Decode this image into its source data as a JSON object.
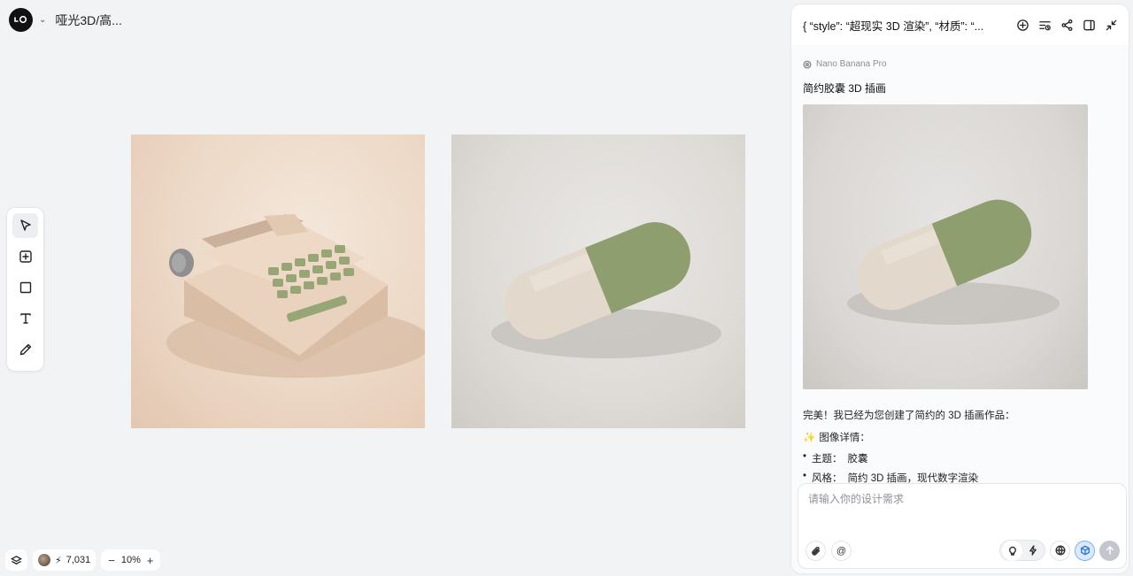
{
  "project": {
    "title": "哑光3D/高..."
  },
  "tools": [
    {
      "name": "select-tool",
      "icon": "cursor-icon",
      "active": true
    },
    {
      "name": "add-frame-tool",
      "icon": "add-square-icon",
      "active": false
    },
    {
      "name": "rectangle-tool",
      "icon": "square-icon",
      "active": false
    },
    {
      "name": "text-tool",
      "icon": "text-icon",
      "active": false
    },
    {
      "name": "pen-tool",
      "icon": "pen-icon",
      "active": false
    }
  ],
  "canvas": {
    "images": [
      {
        "subject": "typewriter",
        "bg": "#ecd8c6",
        "body": "#e6cdb5",
        "keys": "#98a675"
      },
      {
        "subject": "capsule",
        "bg": "#dedbd7",
        "left_color": "#e3d8cc",
        "right_color": "#8e9e6e"
      }
    ]
  },
  "status": {
    "credits": "7,031",
    "zoom": "10%",
    "zoom_out": "−",
    "zoom_in": "+",
    "bolt": "⚡"
  },
  "panel": {
    "title": "{ “style”: “超现实 3D 渲染”, “材质”: “...",
    "model": "Nano Banana Pro",
    "message_title": "简约胶囊 3D 插画",
    "reply": "完美！我已经为您创建了简约的 3D 插画作品：",
    "details_heading": "图像详情：",
    "details_emoji": "✨",
    "bullets": [
      {
        "key": "主题：",
        "value": "胶囊"
      },
      {
        "key": "风格：",
        "value": "简约 3D 插画，现代数字渲染"
      }
    ],
    "input_placeholder": "请输入你的设计需求",
    "mention": "@"
  },
  "colors": {
    "accent": "#2f7be0",
    "capsule_green": "#8e9e6e",
    "capsule_cream": "#e3d8cc"
  }
}
